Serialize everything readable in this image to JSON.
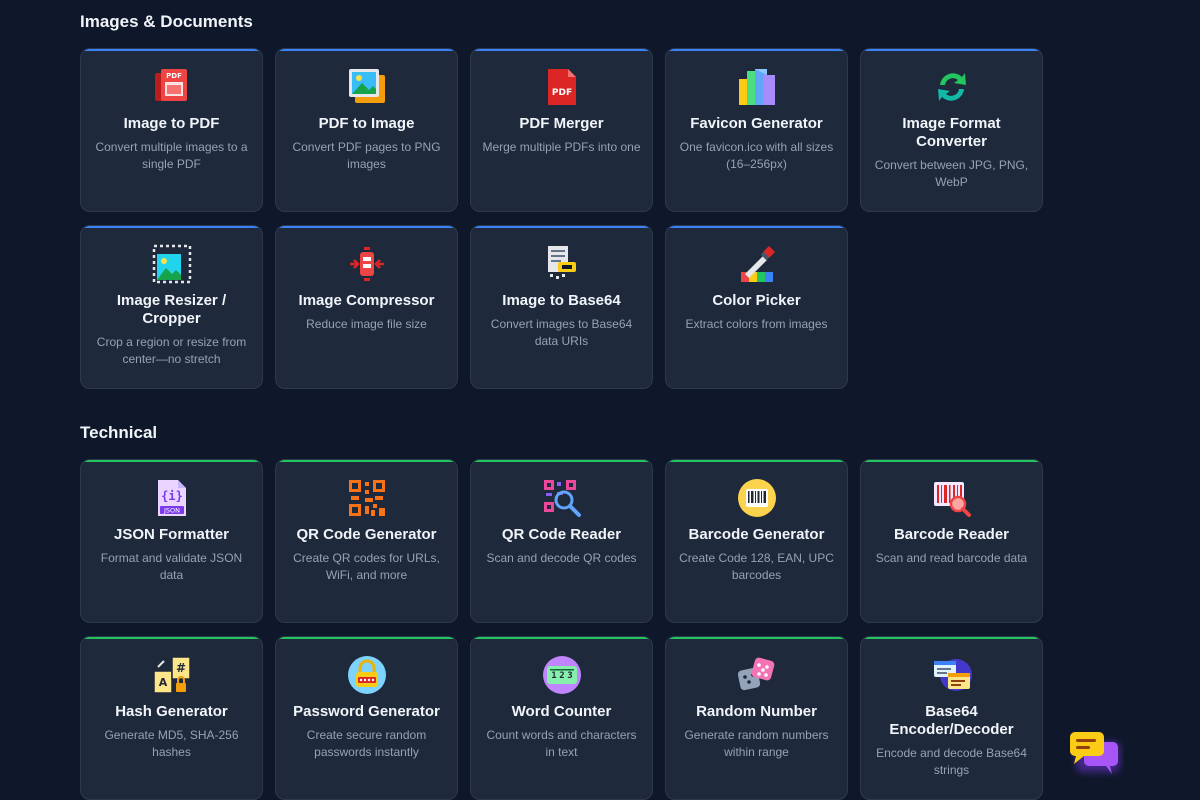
{
  "sections": [
    {
      "title": "Images & Documents",
      "accent": "#3b82f6",
      "tools": [
        {
          "title": "Image to PDF",
          "desc": "Convert multiple images to a single PDF",
          "icon": "image-to-pdf-icon"
        },
        {
          "title": "PDF to Image",
          "desc": "Convert PDF pages to PNG images",
          "icon": "pdf-to-image-icon"
        },
        {
          "title": "PDF Merger",
          "desc": "Merge multiple PDFs into one",
          "icon": "pdf-file-icon"
        },
        {
          "title": "Favicon Generator",
          "desc": "One favicon.ico with all sizes (16–256px)",
          "icon": "favicon-files-icon"
        },
        {
          "title": "Image Format Converter",
          "desc": "Convert between JPG, PNG, WebP",
          "icon": "convert-arrows-icon"
        },
        {
          "title": "Image Resizer / Cropper",
          "desc": "Crop a region or resize from center—no stretch",
          "icon": "crop-image-icon"
        },
        {
          "title": "Image Compressor",
          "desc": "Reduce image file size",
          "icon": "compress-icon"
        },
        {
          "title": "Image to Base64",
          "desc": "Convert images to Base64 data URIs",
          "icon": "base64-file-icon"
        },
        {
          "title": "Color Picker",
          "desc": "Extract colors from images",
          "icon": "eyedropper-icon"
        }
      ]
    },
    {
      "title": "Technical",
      "accent": "#22c55e",
      "tools": [
        {
          "title": "JSON Formatter",
          "desc": "Format and validate JSON data",
          "icon": "json-file-icon"
        },
        {
          "title": "QR Code Generator",
          "desc": "Create QR codes for URLs, WiFi, and more",
          "icon": "qr-code-icon"
        },
        {
          "title": "QR Code Reader",
          "desc": "Scan and decode QR codes",
          "icon": "qr-scan-icon"
        },
        {
          "title": "Barcode Generator",
          "desc": "Create Code 128, EAN, UPC barcodes",
          "icon": "barcode-icon"
        },
        {
          "title": "Barcode Reader",
          "desc": "Scan and read barcode data",
          "icon": "barcode-scan-icon"
        },
        {
          "title": "Hash Generator",
          "desc": "Generate MD5, SHA-256 hashes",
          "icon": "hash-lock-icon"
        },
        {
          "title": "Password Generator",
          "desc": "Create secure random passwords instantly",
          "icon": "password-lock-icon"
        },
        {
          "title": "Word Counter",
          "desc": "Count words and characters in text",
          "icon": "counter-icon"
        },
        {
          "title": "Random Number",
          "desc": "Generate random numbers within range",
          "icon": "dice-icon"
        },
        {
          "title": "Base64 Encoder/Decoder",
          "desc": "Encode and decode Base64 strings",
          "icon": "encode-windows-icon"
        }
      ]
    }
  ],
  "chat": {
    "icon": "chat-bubbles-icon"
  }
}
